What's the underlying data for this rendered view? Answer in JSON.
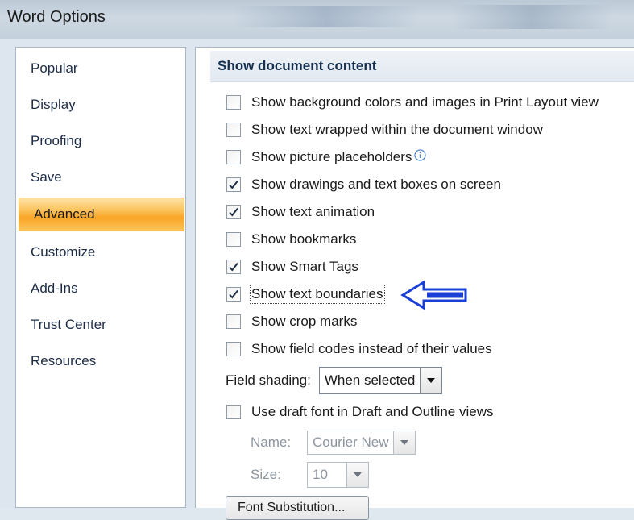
{
  "window": {
    "title": "Word Options"
  },
  "sidebar": {
    "items": [
      {
        "label": "Popular",
        "active": false
      },
      {
        "label": "Display",
        "active": false
      },
      {
        "label": "Proofing",
        "active": false
      },
      {
        "label": "Save",
        "active": false
      },
      {
        "label": "Advanced",
        "active": true
      },
      {
        "label": "Customize",
        "active": false
      },
      {
        "label": "Add-Ins",
        "active": false
      },
      {
        "label": "Trust Center",
        "active": false
      },
      {
        "label": "Resources",
        "active": false
      }
    ]
  },
  "section": {
    "header": "Show document content",
    "options": [
      {
        "label": "Show background colors and images in Print Layout view",
        "checked": false
      },
      {
        "label": "Show text wrapped within the document window",
        "checked": false
      },
      {
        "label": "Show picture placeholders",
        "checked": false,
        "info_icon": "info-icon"
      },
      {
        "label": "Show drawings and text boxes on screen",
        "checked": true
      },
      {
        "label": "Show text animation",
        "checked": true
      },
      {
        "label": "Show bookmarks",
        "checked": false
      },
      {
        "label": "Show Smart Tags",
        "checked": true
      },
      {
        "label": "Show text boundaries",
        "checked": true,
        "focused": true
      },
      {
        "label": "Show crop marks",
        "checked": false
      },
      {
        "label": "Show field codes instead of their values",
        "checked": false
      }
    ],
    "field_shading": {
      "label": "Field shading:",
      "value": "When selected"
    },
    "draft_font": {
      "label": "Use draft font in Draft and Outline views",
      "checked": false
    },
    "name": {
      "label": "Name:",
      "value": "Courier New"
    },
    "size": {
      "label": "Size:",
      "value": "10"
    },
    "font_substitution_button": "Font Substitution..."
  },
  "annotation": {
    "icon": "arrow-left-icon",
    "color": "#1a3fd6"
  }
}
